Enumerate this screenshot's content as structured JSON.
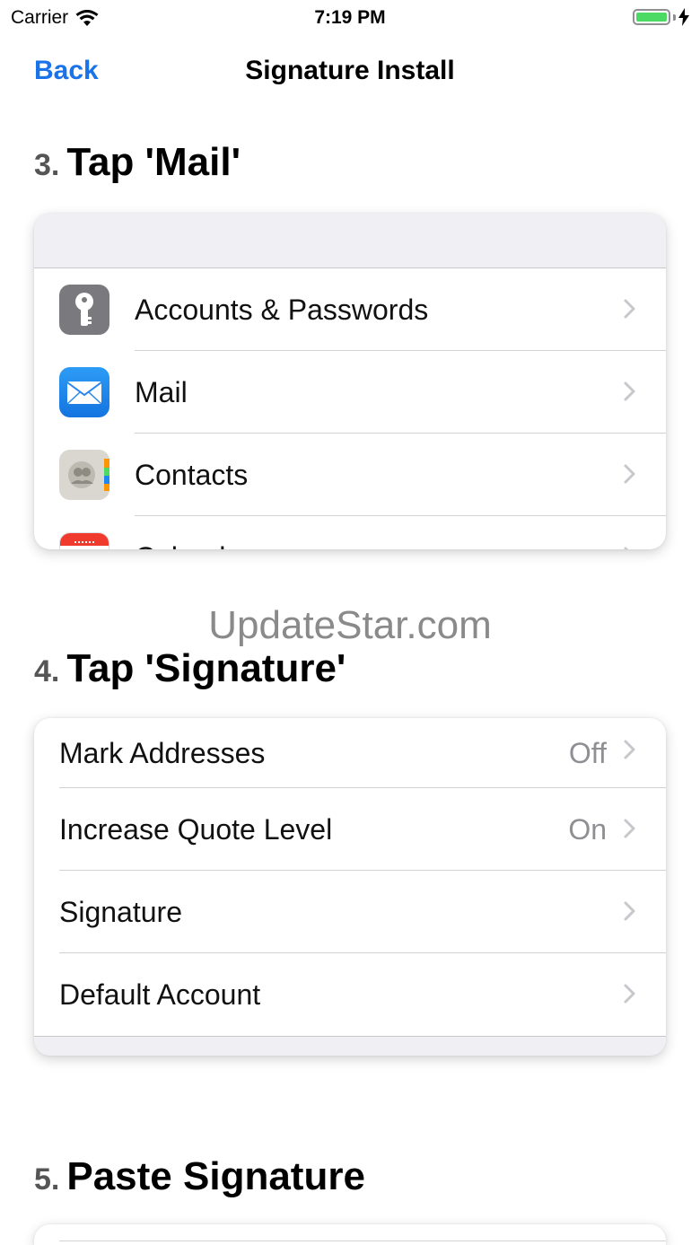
{
  "status": {
    "carrier": "Carrier",
    "time": "7:19 PM"
  },
  "nav": {
    "back": "Back",
    "title": "Signature Install"
  },
  "steps": [
    {
      "num": "3.",
      "text": "Tap 'Mail'"
    },
    {
      "num": "4.",
      "text": "Tap 'Signature'"
    },
    {
      "num": "5.",
      "text": "Paste Signature"
    }
  ],
  "settings_list": [
    {
      "label": "Accounts & Passwords",
      "icon": "key-icon"
    },
    {
      "label": "Mail",
      "icon": "envelope-icon"
    },
    {
      "label": "Contacts",
      "icon": "contacts-icon"
    },
    {
      "label": "Calendar",
      "icon": "calendar-icon"
    }
  ],
  "mail_settings": [
    {
      "label": "Mark Addresses",
      "value": "Off"
    },
    {
      "label": "Increase Quote Level",
      "value": "On"
    },
    {
      "label": "Signature",
      "value": ""
    },
    {
      "label": "Default Account",
      "value": ""
    }
  ],
  "watermark": "UpdateStar.com",
  "colors": {
    "accent": "#1a73e8",
    "battery": "#4cd964",
    "mail_icon": "#1e88f0"
  }
}
